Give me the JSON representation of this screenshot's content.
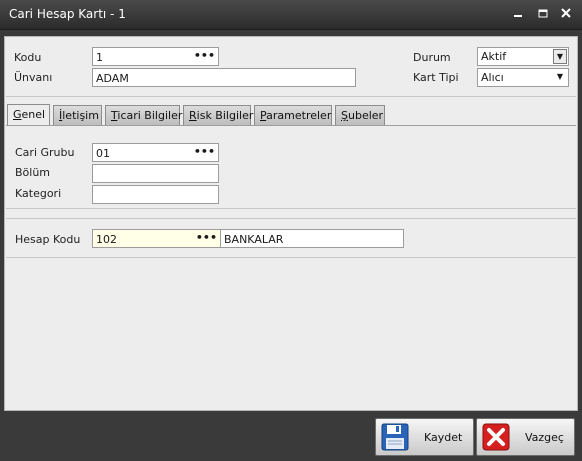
{
  "window": {
    "title": "Cari Hesap Kartı - 1",
    "min": "‗",
    "max": "▭",
    "close": "✕"
  },
  "header": {
    "kodu_label": "Kodu",
    "kodu_value": "1",
    "unvani_label": "Ünvanı",
    "unvani_value": "ADAM",
    "durum_label": "Durum",
    "durum_value": "Aktif",
    "kart_tipi_label": "Kart Tipi",
    "kart_tipi_value": "Alıcı",
    "lookup": "•••"
  },
  "tabs": [
    {
      "u": "G",
      "rest": "enel"
    },
    {
      "u": "İ",
      "rest": "letişim"
    },
    {
      "u": "T",
      "rest": "icari Bilgiler"
    },
    {
      "u": "R",
      "rest": "isk Bilgileri"
    },
    {
      "u": "P",
      "rest": "arametreler"
    },
    {
      "u": "Ş",
      "rest": "ubeler"
    }
  ],
  "genel": {
    "cari_grubu_label": "Cari Grubu",
    "cari_grubu_value": "01",
    "bolum_label": "Bölüm",
    "bolum_value": "",
    "kategori_label": "Kategori",
    "kategori_value": ""
  },
  "hesap": {
    "label": "Hesap Kodu",
    "value": "102",
    "name": "BANKALAR"
  },
  "footer": {
    "save_label": "Kaydet",
    "cancel_label": "Vazgeç"
  },
  "colors": {
    "save_icon": "#2a64b8",
    "cancel_icon": "#d62020"
  }
}
